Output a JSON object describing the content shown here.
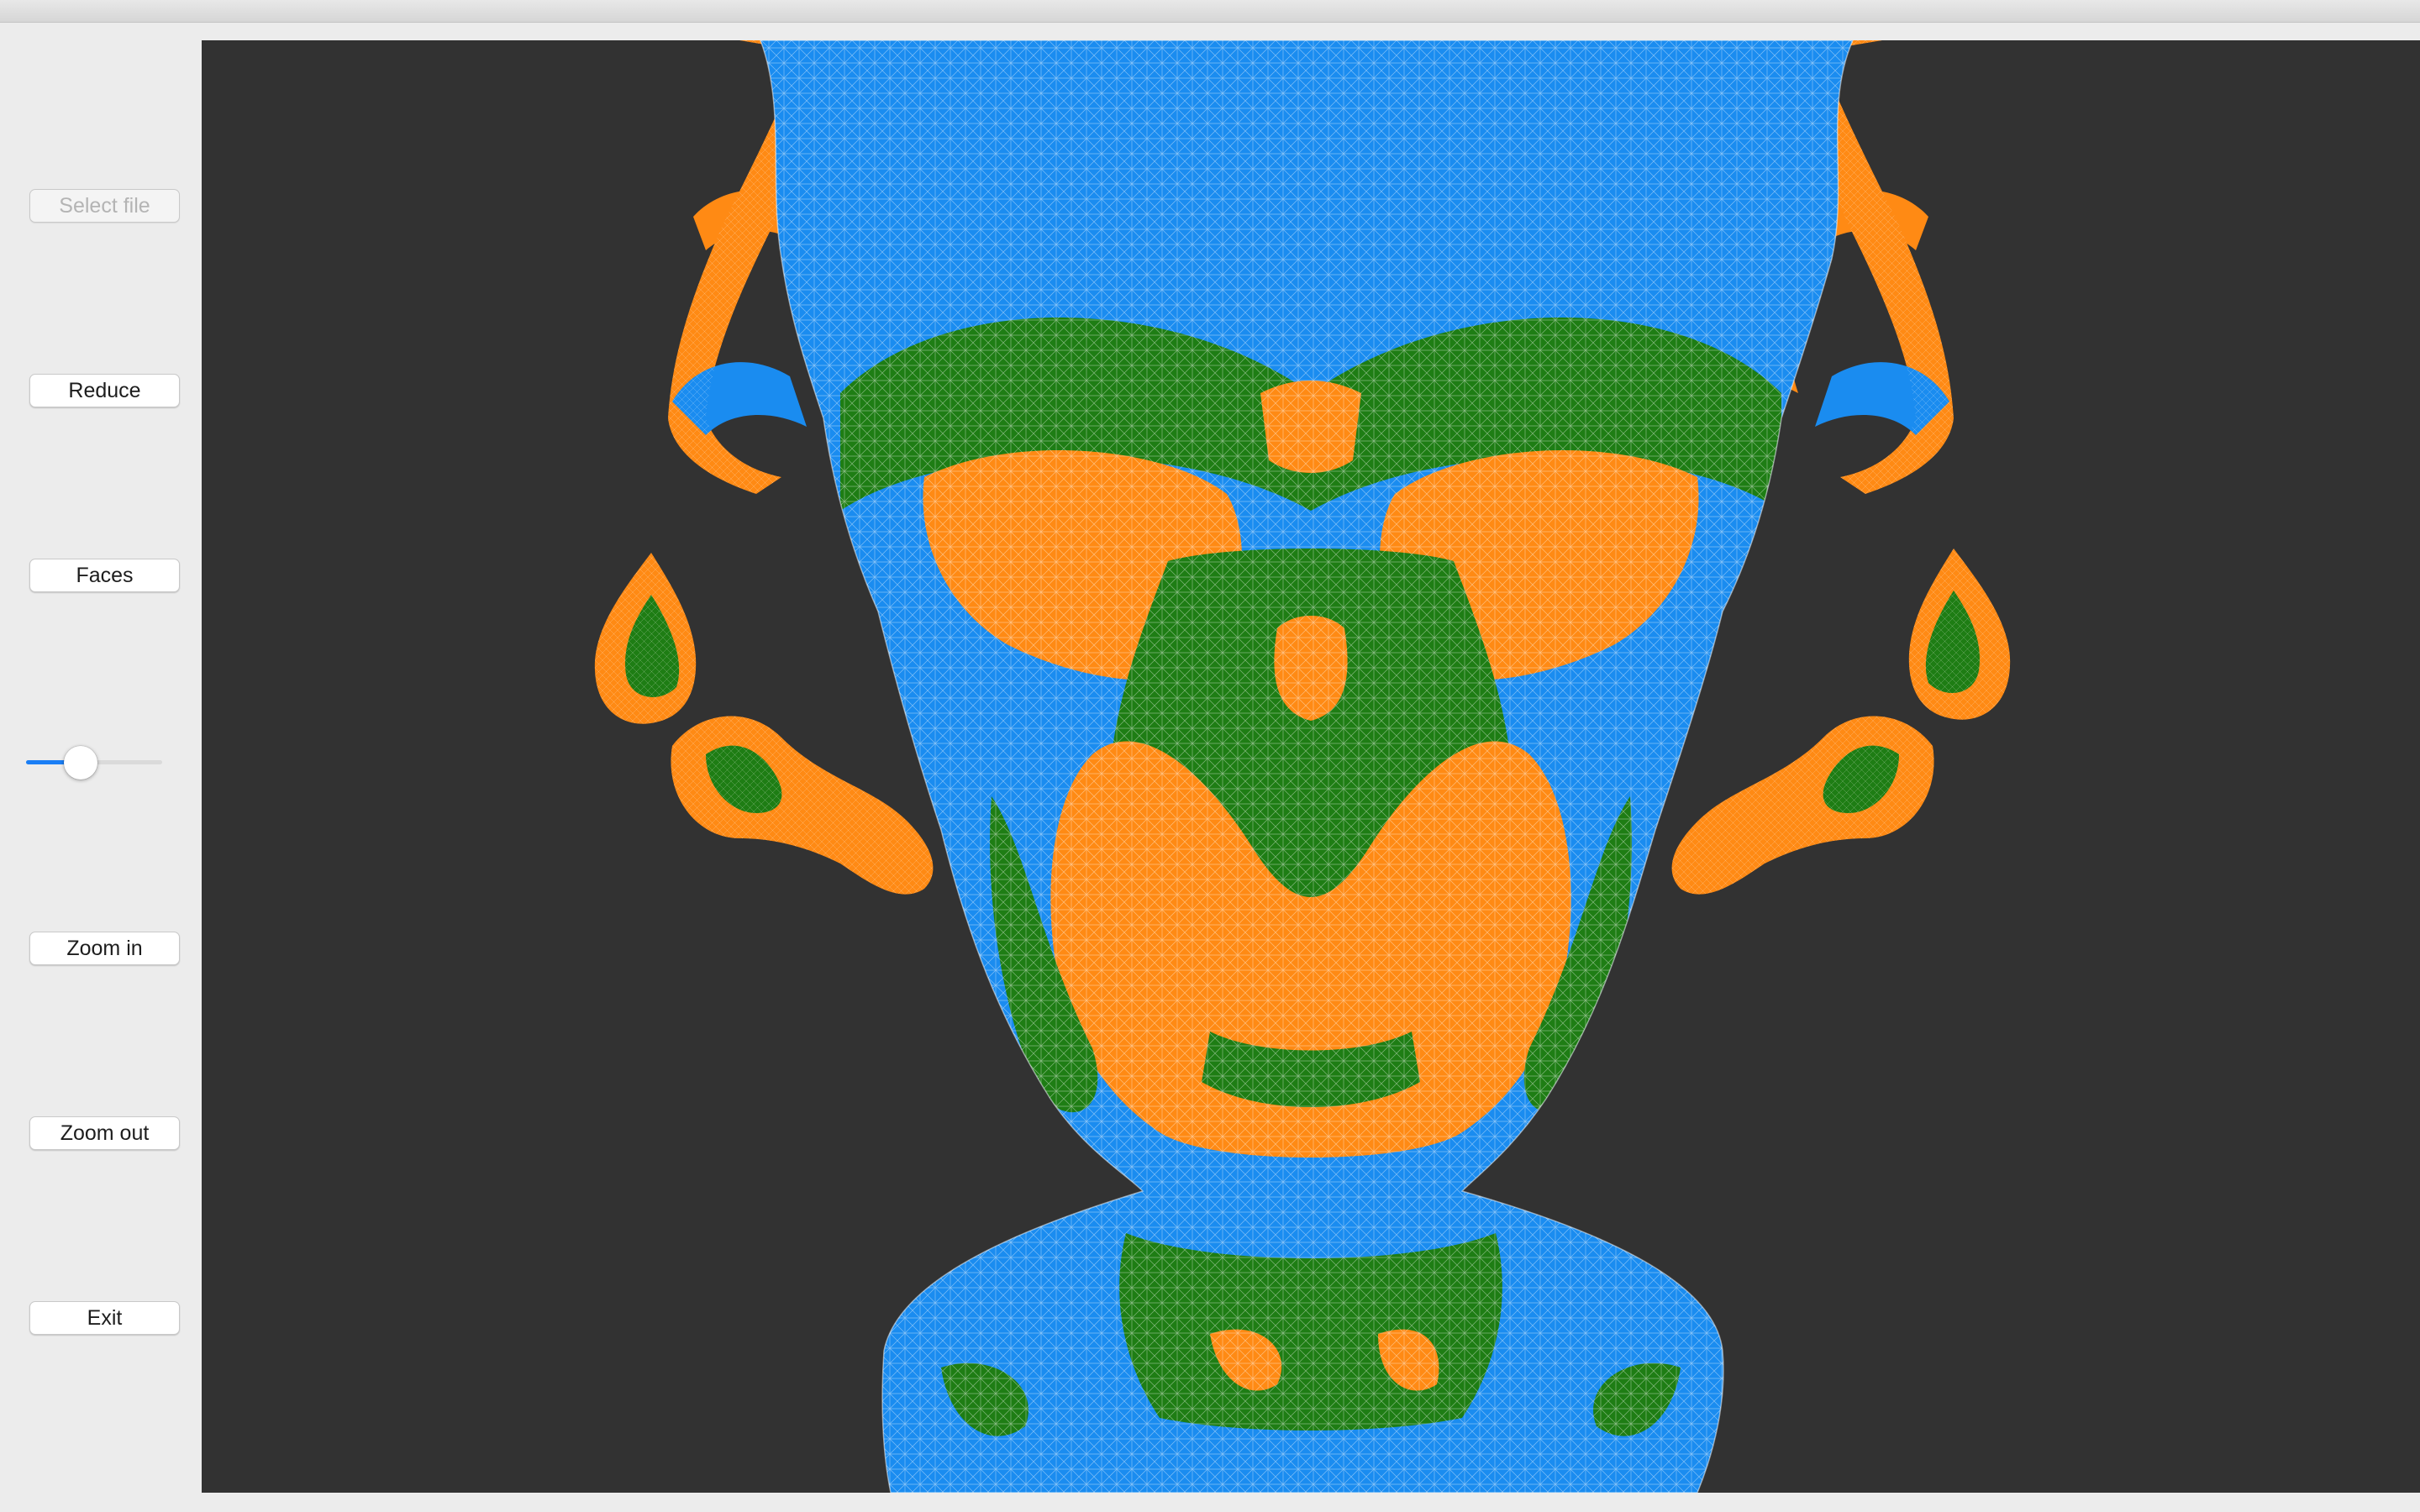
{
  "window": {
    "title": ""
  },
  "sidebar": {
    "select_file_label": "Select file",
    "reduce_label": "Reduce",
    "faces_label": "Faces",
    "zoom_in_label": "Zoom in",
    "zoom_out_label": "Zoom out",
    "exit_label": "Exit",
    "slider": {
      "value_fraction": 0.4
    }
  },
  "viewport": {
    "background_color": "#323232",
    "mesh_colors": {
      "blue": "#1a8cf0",
      "green": "#1e7d14",
      "orange": "#ff8a14",
      "wire": "#ffffff"
    }
  },
  "colors": {
    "accent": "#1a7ef5",
    "window_bg": "#ececec"
  }
}
